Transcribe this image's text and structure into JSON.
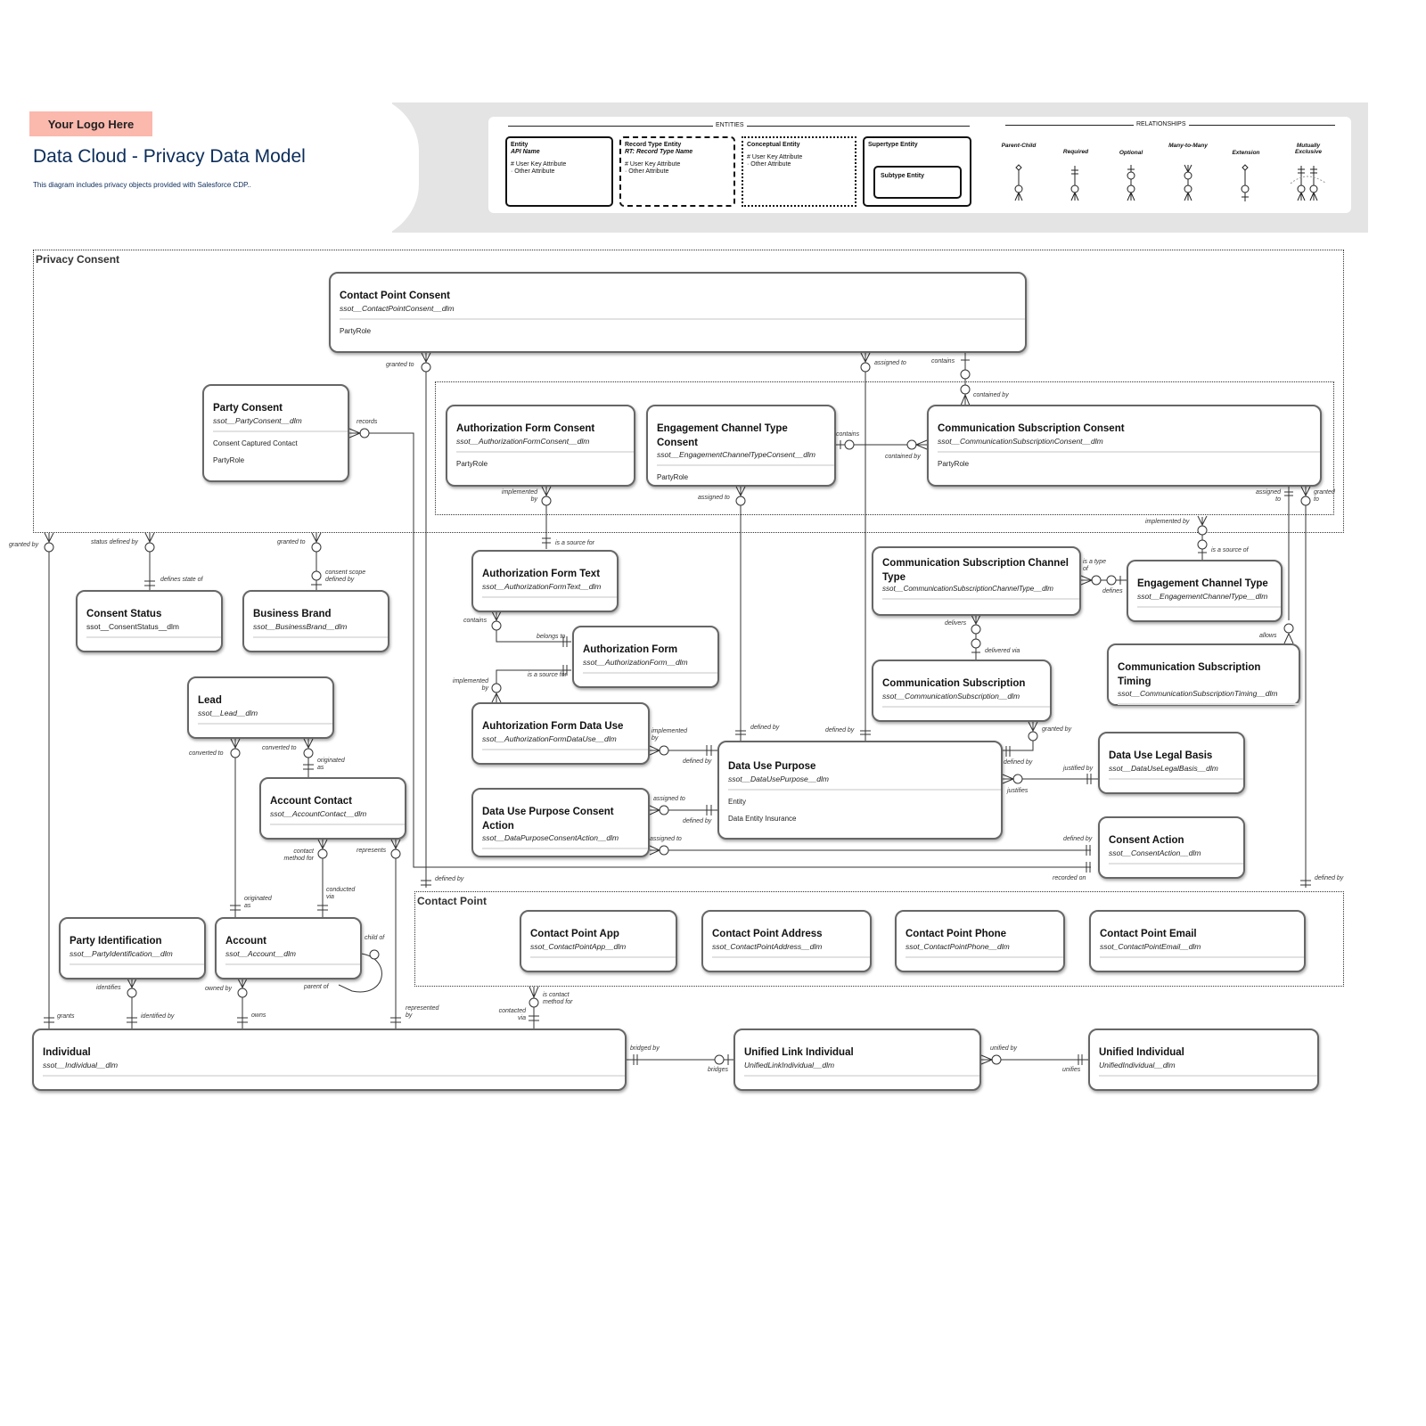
{
  "header": {
    "logo_text": "Your Logo Here",
    "title": "Data Cloud - Privacy Data Model",
    "subtitle": "This diagram includes privacy objects provided with Salesforce CDP.."
  },
  "legend": {
    "entities_heading": "ENTITIES",
    "relationships_heading": "RELATIONSHIPS",
    "entity_types": [
      {
        "title": "Entity",
        "subtitle": "API Name",
        "attrs": [
          "# User Key Attribute",
          "· Other Attribute"
        ],
        "style": "solid"
      },
      {
        "title": "Record Type Entity",
        "subtitle": "RT: Record Type Name",
        "attrs": [
          "# User Key Attribute",
          "· Other Attribute"
        ],
        "style": "dashed"
      },
      {
        "title": "Conceptual Entity",
        "subtitle": "",
        "attrs": [
          "# User Key Attribute",
          "· Other Attribute"
        ],
        "style": "dotted"
      },
      {
        "title": "Supertype Entity",
        "subtitle": "",
        "attrs": [],
        "style": "supertype",
        "child": "Subtype Entity"
      }
    ],
    "relationship_types": [
      "Parent-Child",
      "Required",
      "Optional",
      "Many-to-Many",
      "Extension",
      "Mutually Exclusive"
    ]
  },
  "groups": {
    "privacy_consent": "Privacy Consent",
    "contact_point": "Contact Point"
  },
  "entities": {
    "contact_point_consent": {
      "name": "Contact Point Consent",
      "api": "ssot__ContactPointConsent__dlm",
      "attrs": [
        "PartyRole"
      ]
    },
    "party_consent": {
      "name": "Party Consent",
      "api": "ssot__PartyConsent__dlm",
      "attrs": [
        "Consent Captured Contact",
        "PartyRole"
      ]
    },
    "authorization_form_consent": {
      "name": "Authorization Form Consent",
      "api": "ssot__AuthorizationFormConsent__dlm",
      "attrs": [
        "PartyRole"
      ]
    },
    "engagement_channel_type_consent": {
      "name": "Engagement Channel Type Consent",
      "api": "ssot__EngagementChannelTypeConsent__dlm",
      "attrs": [
        "PartyRole"
      ]
    },
    "communication_subscription_consent": {
      "name": "Communication Subscription Consent",
      "api": "ssot__CommunicationSubscriptionConsent__dlm",
      "attrs": [
        "PartyRole"
      ]
    },
    "consent_status": {
      "name": "Consent Status",
      "api": "ssot__ConsentStatus__dlm",
      "attrs": []
    },
    "business_brand": {
      "name": "Business Brand",
      "api": "ssot__BusinessBrand__dlm",
      "attrs": []
    },
    "authorization_form_text": {
      "name": "Authorization Form Text",
      "api": "ssot__AuthorizationFormText__dlm",
      "attrs": []
    },
    "authorization_form": {
      "name": "Authorization Form",
      "api": "ssot__AuthorizationForm__dlm",
      "attrs": []
    },
    "authorization_form_data_use": {
      "name": "Auhtorization Form Data Use",
      "api": "ssot__AuthorizationFormDataUse__dlm",
      "attrs": []
    },
    "data_use_purpose_consent_action": {
      "name": "Data Use Purpose Consent Action",
      "api": "ssot__DataPurposeConsentAction__dlm",
      "attrs": []
    },
    "communication_subscription_channel_type": {
      "name": "Communication Subscription Channel Type",
      "api": "ssot__CommunicationSubscriptionChannelType__dlm",
      "attrs": []
    },
    "engagement_channel_type": {
      "name": "Engagement Channel Type",
      "api": "ssot__EngagementChannelType__dlm",
      "attrs": []
    },
    "communication_subscription": {
      "name": "Communication Subscription",
      "api": "ssot__CommunicationSubscription__dlm",
      "attrs": []
    },
    "communication_subscription_timing": {
      "name": "Communication Subscription Timing",
      "api": "ssot__CommunicationSubscriptionTiming__dlm",
      "attrs": []
    },
    "data_use_purpose": {
      "name": "Data Use Purpose",
      "api": "ssot__DataUsePurpose__dlm",
      "attrs": [
        "Entity",
        "Data Entity Insurance"
      ]
    },
    "data_use_legal_basis": {
      "name": "Data Use Legal Basis",
      "api": "ssot__DataUseLegalBasis__dlm",
      "attrs": []
    },
    "consent_action": {
      "name": "Consent Action",
      "api": "ssot__ConsentAction__dlm",
      "attrs": []
    },
    "lead": {
      "name": "Lead",
      "api": "ssot__Lead__dlm",
      "attrs": []
    },
    "account_contact": {
      "name": "Account Contact",
      "api": "ssot__AccountContact__dlm",
      "attrs": []
    },
    "party_identification": {
      "name": "Party Identification",
      "api": "ssot__PartyIdentification__dlm",
      "attrs": []
    },
    "account": {
      "name": "Account",
      "api": "ssot__Account__dlm",
      "attrs": []
    },
    "contact_point_app": {
      "name": "Contact Point App",
      "api": "ssot_ContactPointApp__dlm",
      "attrs": []
    },
    "contact_point_address": {
      "name": "Contact Point Address",
      "api": "ssot_ContactPointAddress__dlm",
      "attrs": []
    },
    "contact_point_phone": {
      "name": "Contact Point Phone",
      "api": "ssot_ContactPointPhone__dlm",
      "attrs": []
    },
    "contact_point_email": {
      "name": "Contact Point Email",
      "api": "ssot_ContactPointEmail__dlm",
      "attrs": []
    },
    "individual": {
      "name": "Individual",
      "api": "ssot__Individual__dlm",
      "attrs": []
    },
    "unified_link_individual": {
      "name": "Unified Link Individual",
      "api": "UnifiedLinkIndividual__dlm",
      "attrs": []
    },
    "unified_individual": {
      "name": "Unified Individual",
      "api": "UnifiedIndividual__dlm",
      "attrs": []
    }
  },
  "relationship_labels": {
    "granted_to_cpc": "granted to",
    "assigned_to_cpc": "assigned to",
    "contains_cpc": "contains",
    "contained_by_csc": "contained by",
    "records": "records",
    "contains_ectc": "contains",
    "contained_by_ectc": "contained by",
    "implemented_by_afc": "implemented by",
    "assigned_to_ectc": "assigned to",
    "assigned_to_csc": "assigned to",
    "granted_to_csc": "granted to",
    "implemented_by_ect": "implemented by",
    "is_a_source_of_ect": "is a source of",
    "granted_by": "granted by",
    "status_defined_by": "status defined by",
    "granted_to_bb": "granted to",
    "defines_state_of": "defines state of",
    "consent_scope_defined_by": "consent scope defined by",
    "is_a_source_for_aft": "is a source for",
    "contains_aft": "contains",
    "belongs_to": "belongs to",
    "is_a_source_for_af": "is a source for",
    "implemented_by_afdu": "implemented by",
    "implemented_by_afdu2": "implemented by",
    "defined_by_dup1": "defined by",
    "assigned_to_dupca1": "assigned to",
    "defined_by_dup2": "defined by",
    "assigned_to_dupca2": "assigned to",
    "defined_by_top1": "defined by",
    "defined_by_top2": "defined by",
    "is_a_type_of": "is a type of",
    "defines": "defines",
    "delivers": "delivers",
    "delivered_via": "delivered via",
    "allows": "allows",
    "granted_by_cs": "granted by",
    "defined_by_right": "defined by",
    "justified_by": "justified by",
    "justifies": "justifies",
    "defined_by_ca": "defined by",
    "recorded_on": "recorded on",
    "defined_by_cp": "defined by",
    "defined_by_far": "defined by",
    "converted_to_1": "converted to",
    "converted_to_2": "converted to",
    "originated_as_1": "originated as",
    "contact_method_for": "contact method for",
    "represents": "represents",
    "conducted_via": "conducted via",
    "originated_as_2": "originated as",
    "child_of": "child of",
    "parent_of": "parent of",
    "identifies": "identifies",
    "owned_by": "owned by",
    "grants": "grants",
    "identified_by": "identified by",
    "owns": "owns",
    "represented_by": "represented by",
    "is_contact_method_for": "is contact method for",
    "contacted_via": "contacted via",
    "bridged_by": "bridged by",
    "bridges": "bridges",
    "unified_by": "unified by",
    "unifies": "unifies"
  }
}
